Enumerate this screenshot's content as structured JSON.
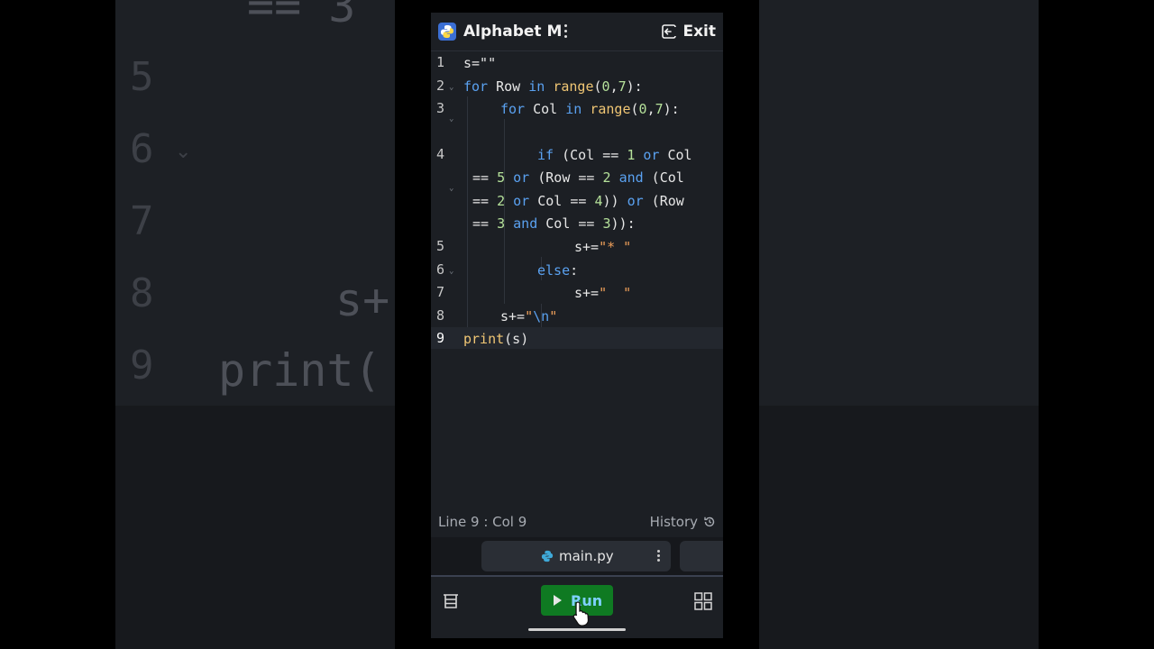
{
  "app": {
    "title": "Alphabet M",
    "exit_label": "Exit"
  },
  "editor": {
    "lines": [
      {
        "num": "1"
      },
      {
        "num": "2"
      },
      {
        "num": "3"
      },
      {
        "num": "4"
      },
      {
        "num": "5"
      },
      {
        "num": "6"
      },
      {
        "num": "7"
      },
      {
        "num": "8"
      },
      {
        "num": "9"
      }
    ],
    "code": {
      "l1": "s=\"\"",
      "l2_kw": "for",
      "l2_a": " Row ",
      "l2_in": "in",
      "l2_fn": "range",
      "l2_n1": "0",
      "l2_n2": "7",
      "l3_kw": "for",
      "l3_a": " Col ",
      "l3_in": "in",
      "l3_fn": "range",
      "l3_n1": "0",
      "l3_n2": "7",
      "l4_if": "if",
      "l4_a": " (Col == ",
      "l4_n1": "1",
      "l4_or": "or",
      "l4_b": " Col",
      "l4w1_a": "== ",
      "l4w1_n": "5",
      "l4w1_or": "or",
      "l4w1_b": " (Row == ",
      "l4w1_n2": "2",
      "l4w1_and": "and",
      "l4w1_c": " (Col",
      "l4w2_a": "== ",
      "l4w2_n": "2",
      "l4w2_or": "or",
      "l4w2_b": " Col == ",
      "l4w2_n2": "4",
      "l4w2_c": ")) ",
      "l4w2_or2": "or",
      "l4w2_d": " (Row",
      "l4w3_a": "== ",
      "l4w3_n": "3",
      "l4w3_and": "and",
      "l4w3_b": " Col == ",
      "l4w3_n2": "3",
      "l4w3_c": ")):",
      "l5_a": "s+=",
      "l5_str": "\"* \"",
      "l6_kw": "else",
      "l6_a": ":",
      "l7_a": "s+=",
      "l7_str": "\"  \"",
      "l8_a": "s+=",
      "l8_str": "\"",
      "l8_esc": "\\n",
      "l8_str2": "\"",
      "l9_fn": "print",
      "l9_a": "(s)"
    }
  },
  "status": {
    "position": "Line 9 : Col 9",
    "history_label": "History"
  },
  "tabs": [
    {
      "name": "main.py"
    }
  ],
  "toolbar": {
    "run_label": "Run"
  },
  "background": {
    "nums": [
      "5",
      "6",
      "7",
      "8",
      "9"
    ],
    "code_top": "== 3",
    "code_s": "s+",
    "code_print": "print("
  },
  "colors": {
    "keyword": "#5aa1f0",
    "function": "#f0c674",
    "number": "#b5e19a",
    "string": "#f0a05a",
    "run_button": "#0f7a22",
    "editor_bg": "#1c1f24"
  }
}
